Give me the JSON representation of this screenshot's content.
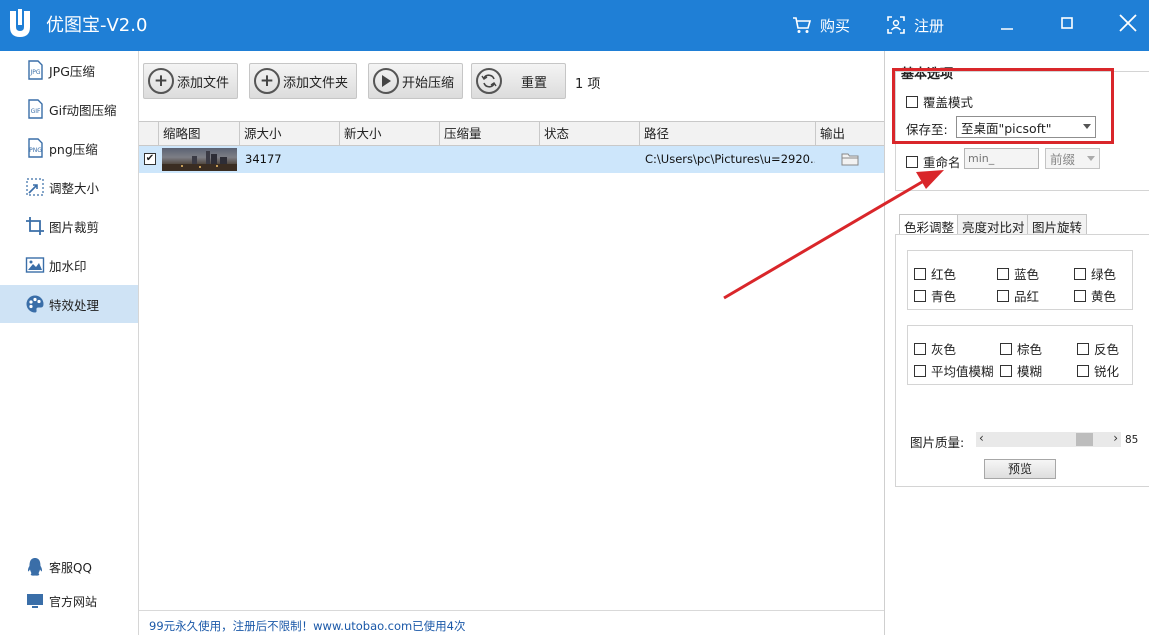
{
  "app": {
    "title": "优图宝-V2.0",
    "buy_label": "购买",
    "register_label": "注册"
  },
  "sidebar": {
    "items": [
      {
        "label": "JPG压缩",
        "icon": "jpg-icon"
      },
      {
        "label": "Gif动图压缩",
        "icon": "gif-icon"
      },
      {
        "label": "png压缩",
        "icon": "png-icon"
      },
      {
        "label": "调整大小",
        "icon": "resize-icon"
      },
      {
        "label": "图片裁剪",
        "icon": "crop-icon"
      },
      {
        "label": "加水印",
        "icon": "image-icon"
      },
      {
        "label": "特效处理",
        "icon": "palette-icon",
        "active": true
      }
    ],
    "footer": [
      {
        "label": "客服QQ",
        "icon": "qq-icon"
      },
      {
        "label": "官方网站",
        "icon": "monitor-icon"
      }
    ]
  },
  "toolbar": {
    "add_file": "添加文件",
    "add_folder": "添加文件夹",
    "start": "开始压缩",
    "reset": "重置",
    "count": "1 项"
  },
  "table": {
    "columns": [
      "缩略图",
      "源大小",
      "新大小",
      "压缩量",
      "状态",
      "路径",
      "输出"
    ],
    "rows": [
      {
        "checked": "✔",
        "source_size": "34177",
        "new_size": "",
        "reduction": "",
        "status": "",
        "path": "C:\\Users\\pc\\Pictures\\u=2920..."
      }
    ]
  },
  "status_bar": {
    "text": "99元永久使用，注册后不限制！www.utobao.com已使用4次"
  },
  "options": {
    "section_title": "基本选项",
    "overwrite_label": "覆盖模式",
    "save_to_label": "保存至:",
    "save_to_value": "至桌面\"picsoft\"",
    "rename_label": "重命名",
    "rename_placeholder": "min_",
    "prefix_value": "前缀"
  },
  "tabs": [
    "色彩调整",
    "亮度对比对",
    "图片旋转"
  ],
  "color_group1": [
    "红色",
    "蓝色",
    "绿色",
    "青色",
    "品红",
    "黄色"
  ],
  "color_group2": [
    "灰色",
    "棕色",
    "反色",
    "平均值模糊",
    "模糊",
    "锐化"
  ],
  "quality": {
    "label": "图片质量:",
    "value": "85",
    "level": 0.85
  },
  "preview_button": "预览",
  "colors": {
    "titlebar": "#1f7fd6",
    "annotation": "#d9262a",
    "active_item": "#cfe3f5"
  }
}
